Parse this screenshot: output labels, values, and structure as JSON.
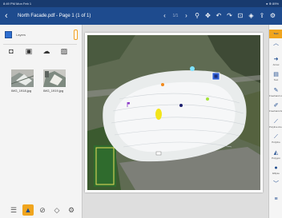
{
  "status_bar": {
    "left": "8:49 PM  Mon Feb 1",
    "right": "● ⊕ 89%"
  },
  "header": {
    "back_icon": "chevron-left-icon",
    "title": "North Facade.pdf - Page 1 (1 of 1)",
    "tools": [
      {
        "name": "previous-page-icon",
        "glyph": "‹",
        "dim": false
      },
      {
        "name": "page-indicator",
        "glyph": "1/1",
        "dim": true
      },
      {
        "name": "next-page-icon",
        "glyph": "›",
        "dim": false
      },
      {
        "name": "search-icon",
        "glyph": "⚲",
        "dim": false
      },
      {
        "name": "move-icon",
        "glyph": "✥",
        "dim": false
      },
      {
        "name": "undo-icon",
        "glyph": "↶",
        "dim": false
      },
      {
        "name": "redo-icon",
        "glyph": "↷",
        "dim": false
      },
      {
        "name": "save-icon",
        "glyph": "⊡",
        "dim": false
      },
      {
        "name": "layers-icon",
        "glyph": "◈",
        "dim": false
      },
      {
        "name": "share-icon",
        "glyph": "⇪",
        "dim": false
      },
      {
        "name": "more-icon",
        "glyph": "⚙",
        "dim": false
      }
    ]
  },
  "left_panel": {
    "layer_label": "Layers",
    "filter_icons": [
      "camera-icon",
      "film-icon",
      "cloud-icon",
      "gallery-icon"
    ],
    "photos": [
      {
        "label": "IMG_1918.jpg"
      },
      {
        "label": "IMG_1919.jpg"
      }
    ],
    "bottom_tabs": [
      "list-icon",
      "photos-icon",
      "attachment-icon",
      "tag-icon",
      "settings-icon"
    ],
    "active_tab": 1
  },
  "markers": [
    {
      "name": "marker-cyan",
      "color": "#7fe3ff"
    },
    {
      "name": "marker-orange",
      "color": "#f28a1c"
    },
    {
      "name": "marker-purple",
      "color": "#8c3cc8"
    },
    {
      "name": "marker-yellow",
      "color": "#f3e51a"
    },
    {
      "name": "marker-navy",
      "color": "#1c1f6e"
    },
    {
      "name": "marker-lime",
      "color": "#a6e33b"
    },
    {
      "name": "marker-blue-square",
      "color": "#2f5fd6"
    }
  ],
  "right_toolbar": {
    "top_label": "Text",
    "items": [
      {
        "name": "collapse-up-icon",
        "glyph": "︿",
        "label": ""
      },
      {
        "name": "arrow-tool-icon",
        "glyph": "➜",
        "label": "Arrow"
      },
      {
        "name": "text-tool-icon",
        "glyph": "▤",
        "label": "Text"
      },
      {
        "name": "freehand-line-icon",
        "glyph": "✎",
        "label": "Freehand Line"
      },
      {
        "name": "freehand-area-icon",
        "glyph": "✐",
        "label": "Freehand Area"
      },
      {
        "name": "polyline-icon",
        "glyph": "⟋",
        "label": "Polyline Area"
      },
      {
        "name": "polyline-line-icon",
        "glyph": "⟋",
        "label": "Polyline"
      },
      {
        "name": "polygon-icon",
        "glyph": "◭",
        "label": "Polygon"
      },
      {
        "name": "ellipse-icon",
        "glyph": "●",
        "label": "Ellipse"
      },
      {
        "name": "collapse-down-icon",
        "glyph": "﹀",
        "label": ""
      },
      {
        "name": "menu-icon",
        "glyph": "≡",
        "label": ""
      }
    ]
  }
}
